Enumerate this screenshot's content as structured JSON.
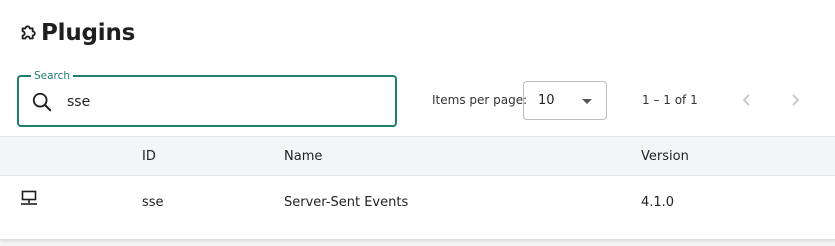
{
  "page": {
    "title": "Plugins",
    "title_icon": "puzzle-icon"
  },
  "search": {
    "label": "Search",
    "value": "sse",
    "icon": "search-icon"
  },
  "pagination": {
    "items_per_page_label": "Items per page:",
    "items_per_page": "10",
    "range_text": "1 – 1 of 1",
    "prev_icon": "chevron-left-icon",
    "next_icon": "chevron-right-icon"
  },
  "table": {
    "columns": [
      "",
      "ID",
      "Name",
      "Version"
    ],
    "rows": [
      {
        "icon": "plugin-type-icon",
        "id": "sse",
        "name": "Server-Sent Events",
        "version": "4.1.0"
      }
    ]
  },
  "colors": {
    "accent": "#1f7f6e",
    "header_bg": "#f3f5f7"
  }
}
